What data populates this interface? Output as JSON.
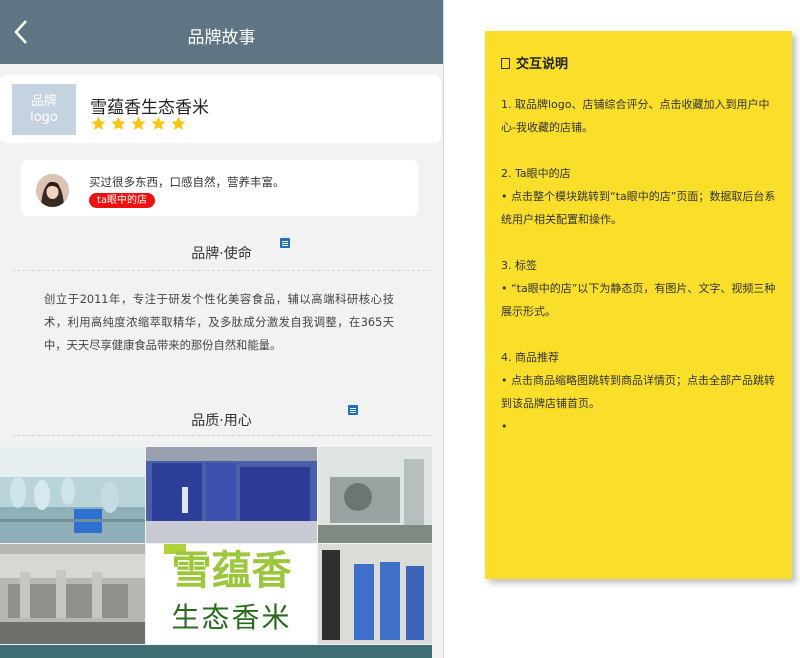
{
  "header": {
    "title": "品牌故事"
  },
  "brand": {
    "logo_line1": "品牌",
    "logo_line2": "logo",
    "name": "雪蕴香生态香米",
    "rating": 5
  },
  "review": {
    "text": "买过很多东西，口感自然，营养丰富。",
    "badge": "ta眼中的店"
  },
  "sections": {
    "mission": {
      "title": "品牌·使命",
      "text": "创立于2011年，专注于研发个性化美容食品，辅以高端科研核心技术，利用高纯度浓缩萃取精华，及多肽成分激发自我调整，在365天中，天天尽享健康食品带来的那份自然和能量。"
    },
    "quality": {
      "title": "品质·用心"
    }
  },
  "photo_banner": {
    "line1": "雪蕴香",
    "line2": "生态香米"
  },
  "annotation": {
    "title": "交互说明",
    "items": [
      {
        "heading": "1. 取品牌logo、店铺综合评分、点击收藏加入到用户中心-我收藏的店铺。",
        "lines": []
      },
      {
        "heading": "2. Ta眼中的店",
        "lines": [
          "• 点击整个模块跳转到“ta眼中的店”页面；数据取后台系统用户相关配置和操作。"
        ]
      },
      {
        "heading": "3. 标签",
        "lines": [
          "• “ta眼中的店”以下为静态页，有图片、文字、视频三种展示形式。"
        ]
      },
      {
        "heading": "4. 商品推荐",
        "lines": [
          "• 点击商品缩略图跳转到商品详情页；点击全部产品跳转到该品牌店铺首页。",
          "•"
        ]
      }
    ]
  },
  "colors": {
    "header_bg": "#5f7584",
    "star": "#f8c613",
    "badge": "#ee1111",
    "note_bg": "#f9df2a"
  }
}
